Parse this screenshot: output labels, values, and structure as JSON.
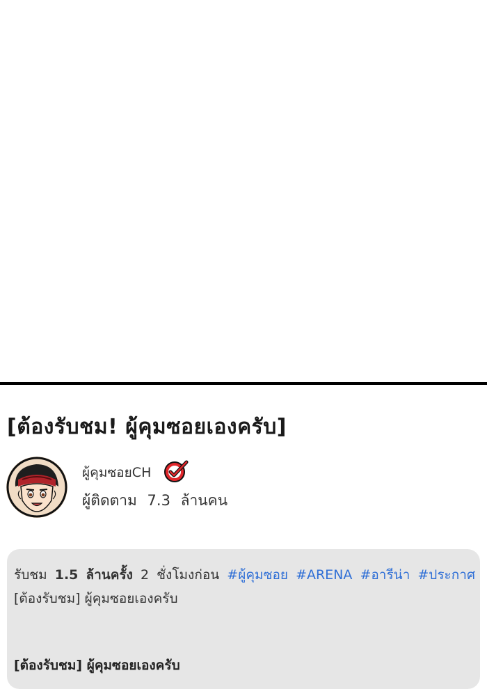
{
  "video": {
    "title": "[ต้องรับชม! ผู้คุมซอยเองครับ]"
  },
  "channel": {
    "name": "ผู้คุมซอยCH",
    "verified_icon": "verified-check-icon",
    "subscribers_label": "ผู้ติดตาม",
    "subscribers_value": "7.3",
    "subscribers_unit": "ล้านคน"
  },
  "description": {
    "views_label": "รับชม",
    "views_value": "1.5",
    "views_unit": "ล้านครั้ง",
    "time_value": "2",
    "time_unit": "ชั่งโมงก่อน",
    "hashtags": [
      "#ผู้คุมซอย",
      "#ARENA",
      "#อารีน่า",
      "#ประกาศ"
    ],
    "line1": "[ต้องรับชม] ผู้คุมซอยเองครับ",
    "line2": "[ต้องรับชม] ผู้คุมซอยเองครับ"
  },
  "colors": {
    "hashtag": "#2f6fd6",
    "badge_red": "#e0262b",
    "description_bg": "#e6e6e6",
    "divider": "#000000"
  }
}
